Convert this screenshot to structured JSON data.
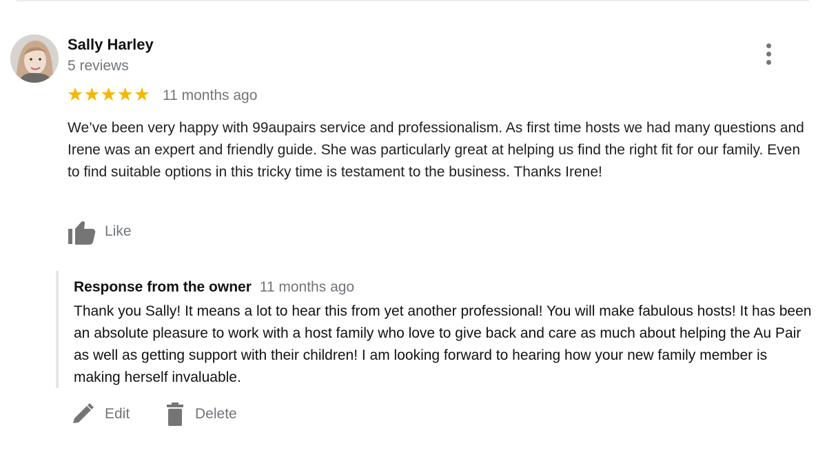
{
  "review": {
    "reviewer_name": "Sally Harley",
    "review_count": "5 reviews",
    "rating": 5,
    "stars": [
      "★",
      "★",
      "★",
      "★",
      "★"
    ],
    "time": "11 months ago",
    "text": "We’ve been very happy with 99aupairs service and professionalism. As first time hosts we had many questions and Irene was an expert and friendly guide. She was particularly great at helping us find the right fit for our family. Even to find suitable options in this tricky time is testament to the business. Thanks Irene!",
    "like_label": "Like"
  },
  "response": {
    "title": "Response from the owner",
    "time": "11 months ago",
    "text": "Thank you Sally! It means a lot to hear this from yet another professional! You will make fabulous hosts! It has been an absolute pleasure to work with a host family who love to give back and care as much about helping the Au Pair as well as getting support with their children! I am looking forward to hearing how your new family member is making herself invaluable."
  },
  "actions": {
    "edit_label": "Edit",
    "delete_label": "Delete"
  },
  "icons": {
    "more": "more-vert-icon",
    "like": "thumb-up-icon",
    "edit": "pencil-icon",
    "delete": "trash-icon"
  },
  "colors": {
    "star": "#f5b700",
    "muted_text": "#70757a",
    "icon": "#757575"
  }
}
